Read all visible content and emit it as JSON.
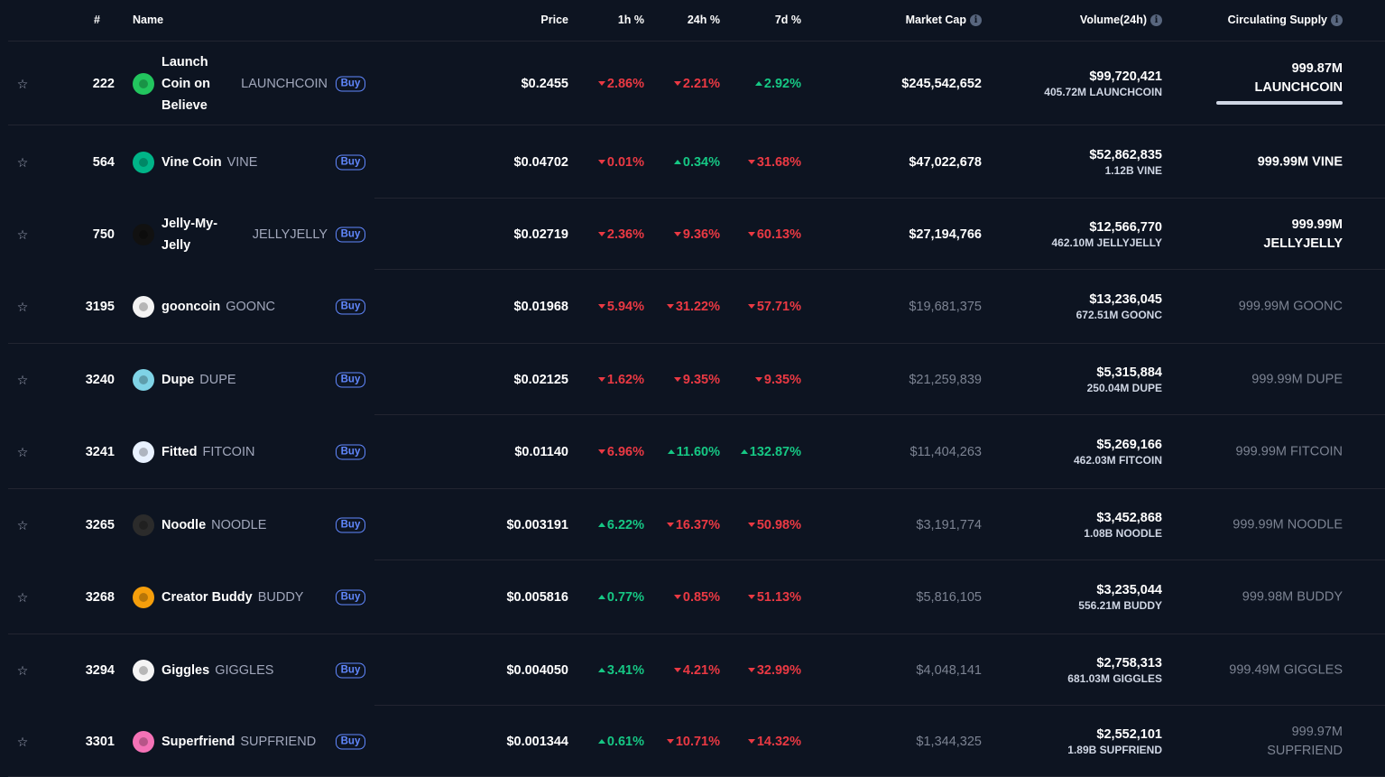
{
  "header": {
    "rank": "#",
    "name": "Name",
    "price": "Price",
    "h1": "1h %",
    "h24": "24h %",
    "d7": "7d %",
    "market_cap": "Market Cap",
    "volume": "Volume(24h)",
    "supply": "Circulating Supply",
    "info_icon_glyph": "i"
  },
  "buy_label": "Buy",
  "star_icon": "☆",
  "rows": [
    {
      "rank": "222",
      "name": "Launch Coin on Believe",
      "symbol": "LAUNCHCOIN",
      "price": "$0.2455",
      "h1": "2.86%",
      "h1_dir": "down",
      "h24": "2.21%",
      "h24_dir": "down",
      "d7": "2.92%",
      "d7_dir": "up",
      "market_cap": "$245,542,652",
      "volume": "$99,720,421",
      "volume_tokens": "405.72M LAUNCHCOIN",
      "supply": "999.87M LAUNCHCOIN",
      "supply_fill": 1.0,
      "logo_color": "#22c55e",
      "logo_icon": "launch-icon"
    },
    {
      "rank": "564",
      "name": "Vine Coin",
      "symbol": "VINE",
      "price": "$0.04702",
      "h1": "0.01%",
      "h1_dir": "down",
      "h24": "0.34%",
      "h24_dir": "up",
      "d7": "31.68%",
      "d7_dir": "down",
      "market_cap": "$47,022,678",
      "volume": "$52,862,835",
      "volume_tokens": "1.12B VINE",
      "supply": "999.99M VINE",
      "logo_color": "#00b488",
      "logo_icon": "vine-icon"
    },
    {
      "rank": "750",
      "name": "Jelly-My-Jelly",
      "symbol": "JELLYJELLY",
      "price": "$0.02719",
      "h1": "2.36%",
      "h1_dir": "down",
      "h24": "9.36%",
      "h24_dir": "down",
      "d7": "60.13%",
      "d7_dir": "down",
      "market_cap": "$27,194,766",
      "volume": "$12,566,770",
      "volume_tokens": "462.10M JELLYJELLY",
      "supply": "999.99M JELLYJELLY",
      "logo_color": "#111111",
      "logo_icon": "jelly-icon"
    },
    {
      "rank": "3195",
      "name": "gooncoin",
      "symbol": "GOONC",
      "price": "$0.01968",
      "h1": "5.94%",
      "h1_dir": "down",
      "h24": "31.22%",
      "h24_dir": "down",
      "d7": "57.71%",
      "d7_dir": "down",
      "market_cap": "$19,681,375",
      "volume": "$13,236,045",
      "volume_tokens": "672.51M GOONC",
      "supply": "999.99M GOONC",
      "logo_color": "#f3f3f3",
      "logo_icon": "goon-icon"
    },
    {
      "rank": "3240",
      "name": "Dupe",
      "symbol": "DUPE",
      "price": "$0.02125",
      "h1": "1.62%",
      "h1_dir": "down",
      "h24": "9.35%",
      "h24_dir": "down",
      "d7": "9.35%",
      "d7_dir": "down",
      "market_cap": "$21,259,839",
      "volume": "$5,315,884",
      "volume_tokens": "250.04M DUPE",
      "supply": "999.99M DUPE",
      "logo_color": "#7fd3e6",
      "logo_icon": "dupe-icon"
    },
    {
      "rank": "3241",
      "name": "Fitted",
      "symbol": "FITCOIN",
      "price": "$0.01140",
      "h1": "6.96%",
      "h1_dir": "down",
      "h24": "11.60%",
      "h24_dir": "up",
      "d7": "132.87%",
      "d7_dir": "up",
      "market_cap": "$11,404,263",
      "volume": "$5,269,166",
      "volume_tokens": "462.03M FITCOIN",
      "supply": "999.99M FITCOIN",
      "logo_color": "#e8f1ff",
      "logo_icon": "fitted-icon"
    },
    {
      "rank": "3265",
      "name": "Noodle",
      "symbol": "NOODLE",
      "price": "$0.003191",
      "h1": "6.22%",
      "h1_dir": "up",
      "h24": "16.37%",
      "h24_dir": "down",
      "d7": "50.98%",
      "d7_dir": "down",
      "market_cap": "$3,191,774",
      "volume": "$3,452,868",
      "volume_tokens": "1.08B NOODLE",
      "supply": "999.99M NOODLE",
      "logo_color": "#2b2b2b",
      "logo_icon": "noodle-icon"
    },
    {
      "rank": "3268",
      "name": "Creator Buddy",
      "symbol": "BUDDY",
      "price": "$0.005816",
      "h1": "0.77%",
      "h1_dir": "up",
      "h24": "0.85%",
      "h24_dir": "down",
      "d7": "51.13%",
      "d7_dir": "down",
      "market_cap": "$5,816,105",
      "volume": "$3,235,044",
      "volume_tokens": "556.21M BUDDY",
      "supply": "999.98M BUDDY",
      "logo_color": "#f59e0b",
      "logo_icon": "buddy-icon"
    },
    {
      "rank": "3294",
      "name": "Giggles",
      "symbol": "GIGGLES",
      "price": "$0.004050",
      "h1": "3.41%",
      "h1_dir": "up",
      "h24": "4.21%",
      "h24_dir": "down",
      "d7": "32.99%",
      "d7_dir": "down",
      "market_cap": "$4,048,141",
      "volume": "$2,758,313",
      "volume_tokens": "681.03M GIGGLES",
      "supply": "999.49M GIGGLES",
      "logo_color": "#f4f4f4",
      "logo_icon": "giggles-icon"
    },
    {
      "rank": "3301",
      "name": "Superfriend",
      "symbol": "SUPFRIEND",
      "price": "$0.001344",
      "h1": "0.61%",
      "h1_dir": "up",
      "h24": "10.71%",
      "h24_dir": "down",
      "d7": "14.32%",
      "d7_dir": "down",
      "market_cap": "$1,344,325",
      "volume": "$2,552,101",
      "volume_tokens": "1.89B SUPFRIEND",
      "supply": "999.97M SUPFRIEND",
      "logo_color": "#f472b6",
      "logo_icon": "superfriend-icon"
    }
  ]
}
